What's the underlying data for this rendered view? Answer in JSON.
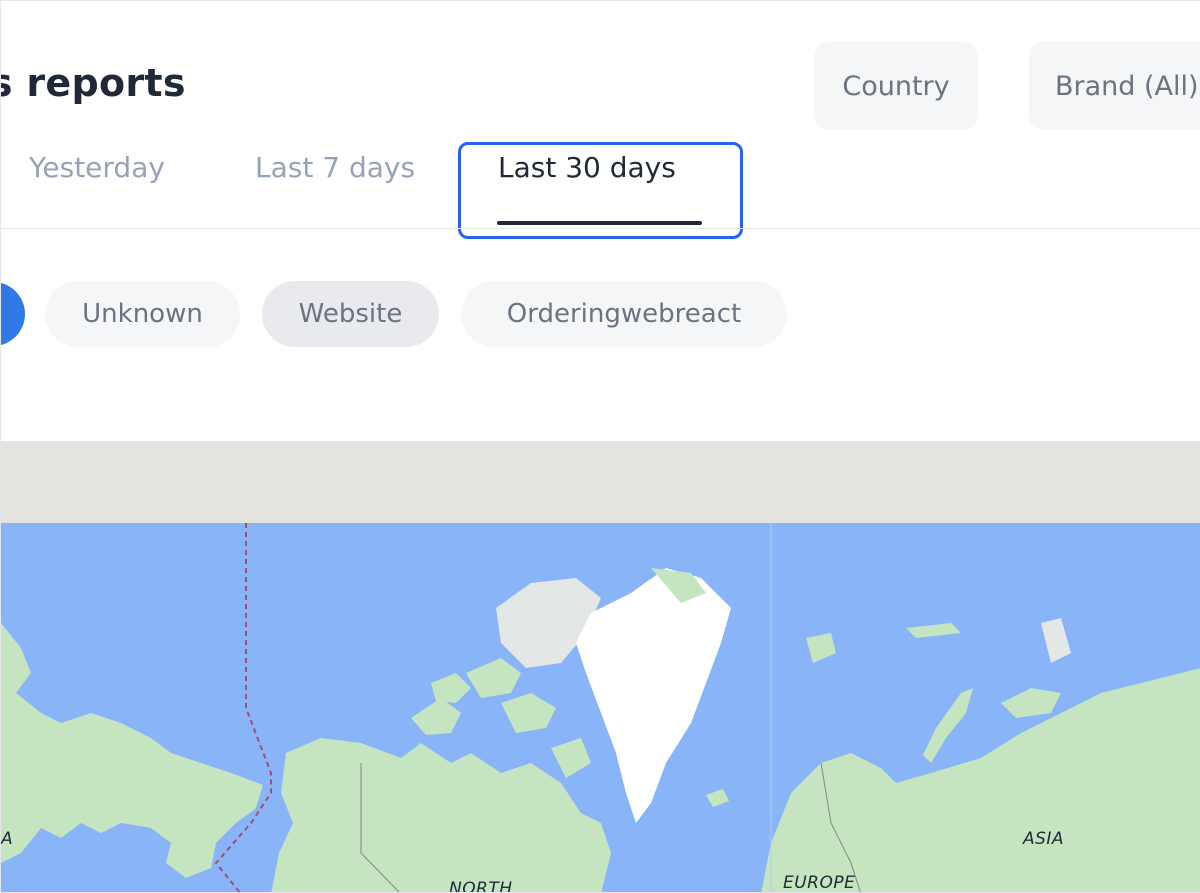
{
  "header": {
    "title": "ss reports",
    "country_label": "Country",
    "brand_label": "Brand (All)"
  },
  "tabs": [
    {
      "label": "Yesterday",
      "active": false
    },
    {
      "label": "Last 7 days",
      "active": false
    },
    {
      "label": "Last 30 days",
      "active": true
    }
  ],
  "filters": {
    "chips": [
      {
        "label": "Unknown",
        "selected": false
      },
      {
        "label": "Website",
        "selected": true
      },
      {
        "label": "Orderingwebreact",
        "selected": false
      }
    ]
  },
  "map": {
    "labels": {
      "a": "A",
      "north": "NORTH",
      "europe": "EUROPE",
      "asia": "ASIA"
    },
    "colors": {
      "water": "#8ab4f8",
      "land": "#c5e4c0",
      "ice": "#ffffff",
      "header_strip": "#e5e3df"
    }
  },
  "colors": {
    "accent": "#2563eb",
    "chip_active": "#2f7ae5",
    "text_dark": "#1f2937",
    "text_muted": "#94a3b8"
  }
}
